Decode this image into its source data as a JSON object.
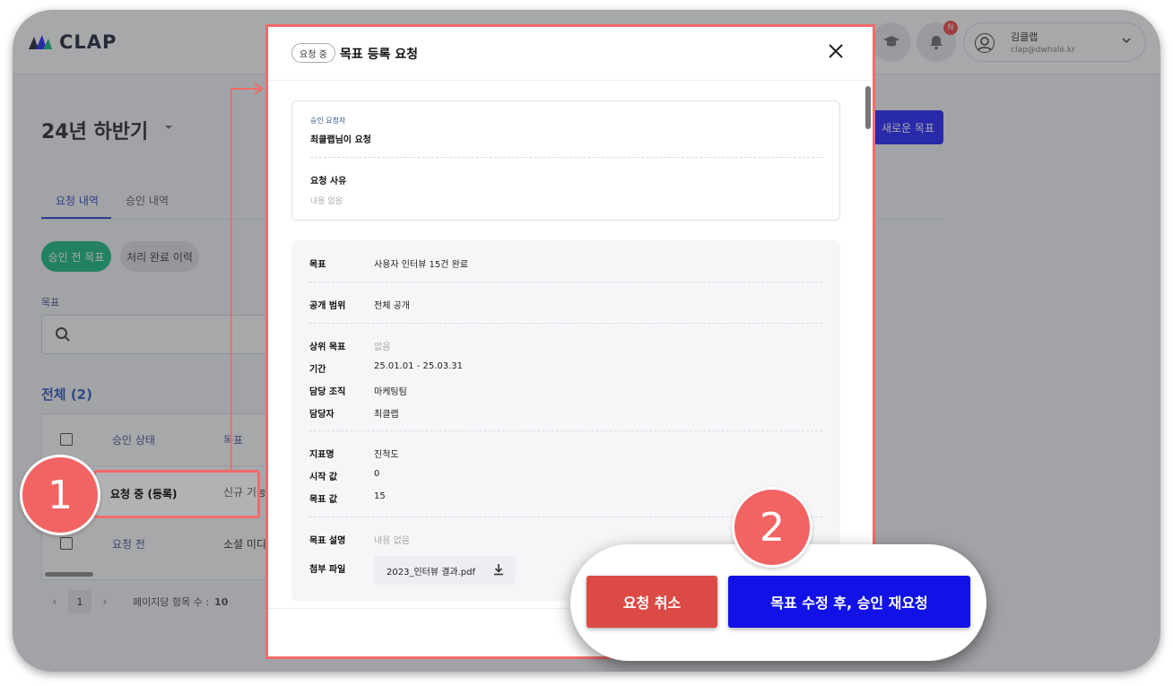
{
  "app": {
    "logo_text": "CLAP",
    "notification_badge": "N",
    "user": {
      "name": "김클랩",
      "email": "clap@dwhale.kr"
    }
  },
  "page": {
    "title": "24년 하반기",
    "new_goal_button": "새로운 목표",
    "tabs": [
      {
        "label": "요청 내역",
        "active": true
      },
      {
        "label": "승인 내역",
        "active": false
      }
    ],
    "filters": [
      {
        "label": "승인 전 목표",
        "active": true
      },
      {
        "label": "처리 완료 이력",
        "active": false
      }
    ],
    "goal_label": "목표",
    "total_label": "전체 (2)",
    "table": {
      "headers": {
        "status": "승인 상태",
        "goal": "목표"
      },
      "rows": [
        {
          "status": "요청 중 (등록)",
          "goal": "신규 기능"
        },
        {
          "status": "요청 전",
          "goal": "소셜 미디어"
        }
      ]
    },
    "pagination": {
      "prev": "‹",
      "page": "1",
      "next": "›",
      "page_size_label": "페이지당 항목 수 :",
      "page_size": "10"
    }
  },
  "modal": {
    "status_pill": "요청 중",
    "title": "목표 등록 요청",
    "request_card": {
      "requester_label": "승인 요청자",
      "requester_value": "최클랩님이 요청",
      "reason_label": "요청 사유",
      "reason_value": "내용 없음"
    },
    "details": {
      "goal": {
        "label": "목표",
        "value": "사용자 인터뷰 15건 완료"
      },
      "scope": {
        "label": "공개 범위",
        "value": "전체 공개"
      },
      "parent": {
        "label": "상위 목표",
        "value": "없음"
      },
      "period": {
        "label": "기간",
        "value": "25.01.01 - 25.03.31"
      },
      "org": {
        "label": "담당 조직",
        "value": "마케팅팀"
      },
      "owner": {
        "label": "담당자",
        "value": "최클랩"
      },
      "metric": {
        "label": "지표명",
        "value": "진척도"
      },
      "start": {
        "label": "시작 값",
        "value": "0"
      },
      "target": {
        "label": "목표 값",
        "value": "15"
      },
      "description": {
        "label": "목표 설명",
        "value": "내용 없음"
      },
      "attachment": {
        "label": "첨부 파일",
        "value": "2023_인터뷰 결과.pdf"
      }
    },
    "buttons": {
      "cancel": "요청 취소",
      "rerequest": "목표 수정 후, 승인 재요청"
    }
  },
  "annotations": {
    "step1": "1",
    "step2": "2"
  },
  "colors": {
    "primary": "#1212e6",
    "danger": "#dc4a45",
    "green": "#0db87a",
    "highlight": "#f46a6a",
    "callout": "#f26363"
  }
}
